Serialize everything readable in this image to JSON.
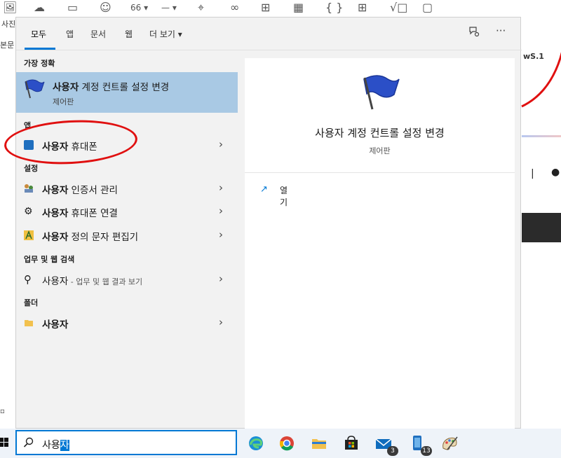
{
  "background_app": {
    "toolbar_icons": [
      "image-icon",
      "cloud-icon",
      "video-icon",
      "emoji-icon",
      "quote-icon",
      "line-icon",
      "location-icon",
      "link-icon",
      "add-box-icon",
      "calendar-icon",
      "braces-icon",
      "table-icon",
      "formula-icon",
      "comment-icon"
    ],
    "label_photo": "사진",
    "label_body": "본문",
    "quote_glyph": "66",
    "dash_glyph": "—",
    "fragment_text": "wS.1"
  },
  "search_panel": {
    "tabs": [
      "모두",
      "앱",
      "문서",
      "웹",
      "더 보기"
    ],
    "active_tab": "모두",
    "best_match": {
      "heading": "가장 정확",
      "title_bold": "사용자",
      "title_rest": " 계정 컨트롤 설정 변경",
      "subtitle": "제어판"
    },
    "apps": {
      "heading": "앱",
      "items": [
        {
          "bold": "사용자",
          "rest": " 휴대폰"
        }
      ]
    },
    "settings": {
      "heading": "설정",
      "items": [
        {
          "bold": "사용자",
          "rest": " 인증서 관리"
        },
        {
          "bold": "사용자",
          "rest": " 휴대폰 연결"
        },
        {
          "bold": "사용자",
          "rest": " 정의 문자 편집기"
        }
      ]
    },
    "web": {
      "heading": "업무 및 웹 검색",
      "items": [
        {
          "bold": "사용자",
          "rest": " - 업무 및 웹 결과 보기"
        }
      ]
    },
    "folders": {
      "heading": "폴더",
      "items": [
        {
          "bold": "사용자",
          "rest": ""
        }
      ]
    },
    "detail": {
      "title": "사용자 계정 컨트롤 설정 변경",
      "subtitle": "제어판",
      "actions": [
        {
          "label": "열기",
          "icon": "open-window-icon"
        }
      ]
    }
  },
  "taskbar": {
    "search_query_prefix": "사용",
    "search_query_selected": "자",
    "apps": [
      {
        "name": "edge",
        "badge": ""
      },
      {
        "name": "chrome",
        "badge": ""
      },
      {
        "name": "file-explorer",
        "badge": ""
      },
      {
        "name": "store",
        "badge": ""
      },
      {
        "name": "mail",
        "badge": "3"
      },
      {
        "name": "phone",
        "badge": "13"
      },
      {
        "name": "paint",
        "badge": ""
      }
    ]
  },
  "colors": {
    "accent": "#0078d4",
    "best_match_highlight": "#a9c9e4",
    "annotation": "#e01010"
  }
}
